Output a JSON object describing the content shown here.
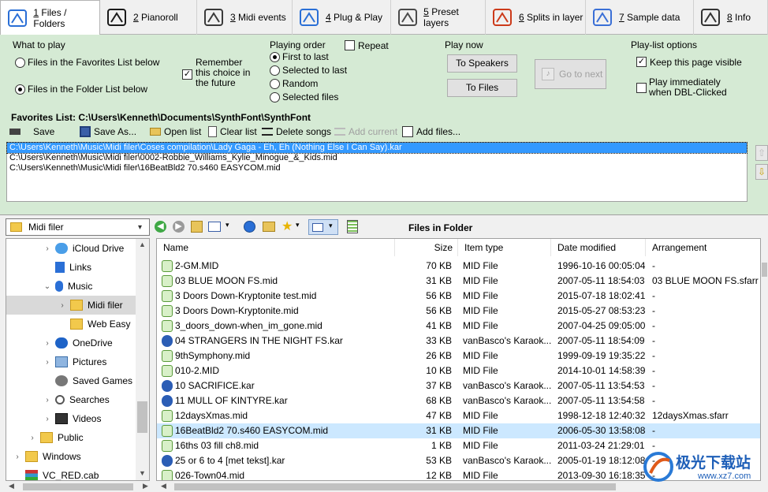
{
  "tabs": [
    {
      "num": "1",
      "label": " Files / Folders",
      "icon": "folders-icon",
      "active": true
    },
    {
      "num": "2",
      "label": " Pianoroll",
      "icon": "pianoroll-icon"
    },
    {
      "num": "3",
      "label": " Midi events",
      "icon": "midi-events-icon"
    },
    {
      "num": "4",
      "label": " Plug & Play",
      "icon": "go-icon"
    },
    {
      "num": "5",
      "label": " Preset layers",
      "icon": "preset-layers-icon"
    },
    {
      "num": "6",
      "label": " Splits in layer",
      "icon": "splits-icon"
    },
    {
      "num": "7",
      "label": " Sample data",
      "icon": "sample-data-icon"
    },
    {
      "num": "8",
      "label": " Info",
      "icon": "info-icon"
    }
  ],
  "what_to_play": {
    "title": "What to play",
    "opt_favorites": "Files in the Favorites List below",
    "opt_folder": "Files in the Folder List below",
    "remember": "Remember this choice in the future"
  },
  "playing_order": {
    "title": "Playing order",
    "repeat": "Repeat",
    "options": [
      "First to last",
      "Selected to last",
      "Random",
      "Selected files"
    ]
  },
  "play_now": {
    "title": "Play now",
    "to_speakers": "To Speakers",
    "to_files": "To Files",
    "go_to_next": "Go to next"
  },
  "playlist_options": {
    "title": "Play-list options",
    "keep_visible": "Keep this page visible",
    "play_immediately": "Play immediately when DBL-Clicked"
  },
  "favorites": {
    "title": "Favorites List: C:\\Users\\Kenneth\\Documents\\SynthFont\\SynthFont",
    "toolbar": {
      "save": "Save",
      "save_as": "Save As...",
      "open_list": "Open list",
      "clear_list": "Clear list",
      "delete_songs": "Delete songs",
      "add_current": "Add current",
      "add_files": "Add files..."
    },
    "items": [
      "C:\\Users\\Kenneth\\Music\\Midi filer\\Coses compilation\\Lady Gaga - Eh, Eh (Nothing Else I Can Say).kar",
      "C:\\Users\\Kenneth\\Music\\Midi filer\\0002-Robbie_Williams_Kylie_Minogue_&_Kids.mid",
      "C:\\Users\\Kenneth\\Music\\Midi filer\\16BeatBld2 70.s460 EASYCOM.mid"
    ]
  },
  "folder_combo": "Midi filer",
  "files_in_folder_title": "Files in Folder",
  "tree": [
    {
      "label": "iCloud Drive",
      "icon": "icloud-icon",
      "indent": 2,
      "chev": ">"
    },
    {
      "label": "Links",
      "icon": "links-icon",
      "indent": 2,
      "chev": ""
    },
    {
      "label": "Music",
      "icon": "music-icon",
      "indent": 2,
      "chev": "v"
    },
    {
      "label": "Midi filer",
      "icon": "folder-icon",
      "indent": 3,
      "chev": ">",
      "selected": true
    },
    {
      "label": "Web Easy",
      "icon": "folder-icon",
      "indent": 3,
      "chev": ""
    },
    {
      "label": "OneDrive",
      "icon": "onedrive-icon",
      "indent": 2,
      "chev": ">"
    },
    {
      "label": "Pictures",
      "icon": "pictures-icon",
      "indent": 2,
      "chev": ">"
    },
    {
      "label": "Saved Games",
      "icon": "saved-games-icon",
      "indent": 2,
      "chev": ""
    },
    {
      "label": "Searches",
      "icon": "search-icon",
      "indent": 2,
      "chev": ">"
    },
    {
      "label": "Videos",
      "icon": "videos-icon",
      "indent": 2,
      "chev": ">"
    },
    {
      "label": "Public",
      "icon": "folder-icon",
      "indent": 1,
      "chev": ">"
    },
    {
      "label": "Windows",
      "icon": "folder-icon",
      "indent": 0,
      "chev": ">"
    },
    {
      "label": "VC_RED.cab",
      "icon": "cab-icon",
      "indent": 0,
      "chev": ""
    }
  ],
  "columns": [
    "Name",
    "Size",
    "Item type",
    "Date modified",
    "Arrangement"
  ],
  "files": [
    {
      "name": "2-GM.MID",
      "size": "70 KB",
      "type": "MID File",
      "date": "1996-10-16 00:05:04",
      "arr": "-",
      "icon": "mid"
    },
    {
      "name": "03 BLUE MOON FS.mid",
      "size": "31 KB",
      "type": "MID File",
      "date": "2007-05-11 18:54:03",
      "arr": "03 BLUE MOON FS.sfarr",
      "icon": "mid"
    },
    {
      "name": "3 Doors Down-Kryptonite test.mid",
      "size": "56 KB",
      "type": "MID File",
      "date": "2015-07-18 18:02:41",
      "arr": "-",
      "icon": "mid"
    },
    {
      "name": "3 Doors Down-Kryptonite.mid",
      "size": "56 KB",
      "type": "MID File",
      "date": "2015-05-27 08:53:23",
      "arr": "-",
      "icon": "mid"
    },
    {
      "name": "3_doors_down-when_im_gone.mid",
      "size": "41 KB",
      "type": "MID File",
      "date": "2007-04-25 09:05:00",
      "arr": "-",
      "icon": "mid"
    },
    {
      "name": "04 STRANGERS IN THE NIGHT FS.kar",
      "size": "33 KB",
      "type": "vanBasco's Karaok...",
      "date": "2007-05-11 18:54:09",
      "arr": "-",
      "icon": "kar"
    },
    {
      "name": "9thSymphony.mid",
      "size": "26 KB",
      "type": "MID File",
      "date": "1999-09-19 19:35:22",
      "arr": "-",
      "icon": "mid"
    },
    {
      "name": "010-2.MID",
      "size": "10 KB",
      "type": "MID File",
      "date": "2014-10-01 14:58:39",
      "arr": "-",
      "icon": "mid"
    },
    {
      "name": "10 SACRIFICE.kar",
      "size": "37 KB",
      "type": "vanBasco's Karaok...",
      "date": "2007-05-11 13:54:53",
      "arr": "-",
      "icon": "kar"
    },
    {
      "name": "11 MULL OF KINTYRE.kar",
      "size": "68 KB",
      "type": "vanBasco's Karaok...",
      "date": "2007-05-11 13:54:58",
      "arr": "-",
      "icon": "kar"
    },
    {
      "name": "12daysXmas.mid",
      "size": "47 KB",
      "type": "MID File",
      "date": "1998-12-18 12:40:32",
      "arr": "12daysXmas.sfarr",
      "icon": "mid"
    },
    {
      "name": "16BeatBld2 70.s460 EASYCOM.mid",
      "size": "31 KB",
      "type": "MID File",
      "date": "2006-05-30 13:58:08",
      "arr": "-",
      "icon": "mid",
      "selected": true
    },
    {
      "name": "16ths 03 fill ch8.mid",
      "size": "1 KB",
      "type": "MID File",
      "date": "2011-03-24 21:29:01",
      "arr": "-",
      "icon": "mid"
    },
    {
      "name": "25 or 6 to 4 [met tekst].kar",
      "size": "53 KB",
      "type": "vanBasco's Karaok...",
      "date": "2005-01-19 18:12:08",
      "arr": "-",
      "icon": "kar"
    },
    {
      "name": "026-Town04.mid",
      "size": "12 KB",
      "type": "MID File",
      "date": "2013-09-30 16:18:35",
      "arr": "-",
      "icon": "mid"
    }
  ],
  "watermark": {
    "text": "极光下载站",
    "url": "www.xz7.com"
  },
  "colors": {
    "panel_green": "#d5ead4",
    "selection_blue": "#3399ff",
    "row_selected": "#cce8ff"
  }
}
